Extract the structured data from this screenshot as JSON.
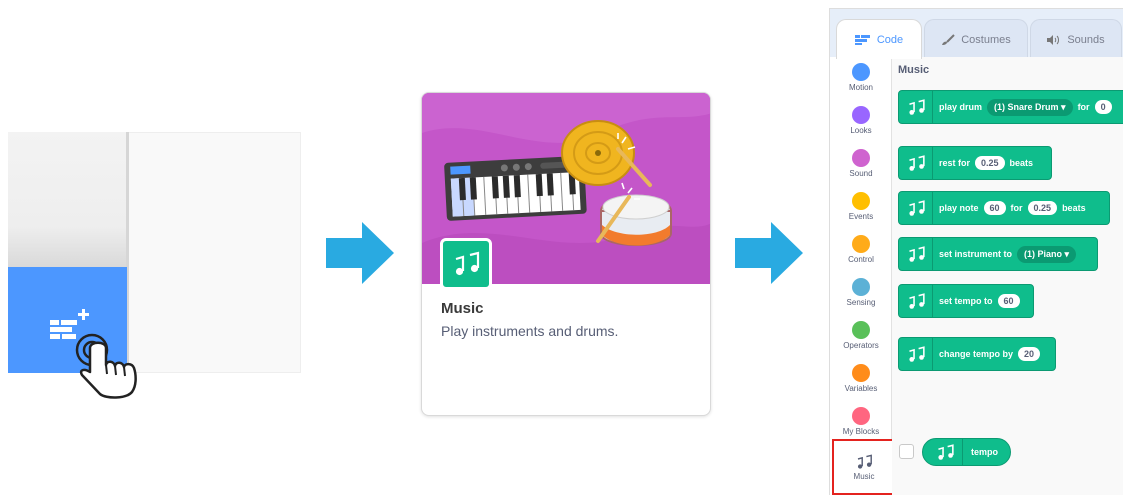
{
  "card": {
    "title": "Music",
    "description": "Play instruments and drums."
  },
  "editor": {
    "tabs": [
      {
        "label": "Code",
        "icon": "code-icon"
      },
      {
        "label": "Costumes",
        "icon": "brush-icon"
      },
      {
        "label": "Sounds",
        "icon": "speaker-icon"
      }
    ],
    "categories": [
      {
        "label": "Motion",
        "color": "#4c97ff"
      },
      {
        "label": "Looks",
        "color": "#9966ff"
      },
      {
        "label": "Sound",
        "color": "#cf63cf"
      },
      {
        "label": "Events",
        "color": "#ffbf00"
      },
      {
        "label": "Control",
        "color": "#ffab19"
      },
      {
        "label": "Sensing",
        "color": "#5cb1d6"
      },
      {
        "label": "Operators",
        "color": "#59c059"
      },
      {
        "label": "Variables",
        "color": "#ff8c1a"
      },
      {
        "label": "My Blocks",
        "color": "#ff6680"
      }
    ],
    "music_category": {
      "label": "Music",
      "icon": "music-notes-icon"
    },
    "section_title": "Music",
    "blocks": {
      "play_drum": {
        "text": "play drum",
        "menu": "(1) Snare Drum ▾",
        "for": "for",
        "value": "0"
      },
      "rest": {
        "text": "rest for",
        "value": "0.25",
        "suffix": "beats"
      },
      "play_note": {
        "text": "play note",
        "note": "60",
        "for": "for",
        "value": "0.25",
        "suffix": "beats"
      },
      "set_instrument": {
        "text": "set instrument to",
        "menu": "(1) Piano ▾"
      },
      "set_tempo": {
        "text": "set tempo to",
        "value": "60"
      },
      "change_tempo": {
        "text": "change tempo by",
        "value": "20"
      },
      "tempo": {
        "text": "tempo"
      }
    }
  },
  "colors": {
    "scratch_blue": "#4c97ff",
    "music_green": "#0fbd8c",
    "arrow_blue": "#29aae1",
    "highlight_red": "#e4231f"
  }
}
